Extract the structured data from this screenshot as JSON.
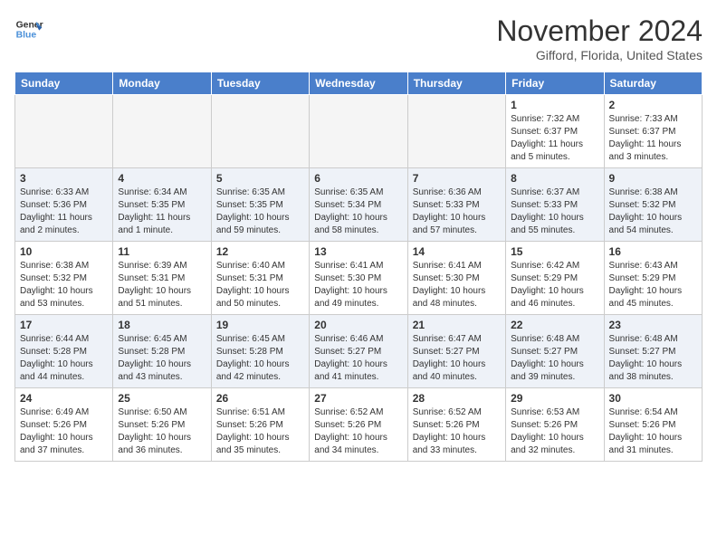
{
  "header": {
    "logo_line1": "General",
    "logo_line2": "Blue",
    "month": "November 2024",
    "location": "Gifford, Florida, United States"
  },
  "weekdays": [
    "Sunday",
    "Monday",
    "Tuesday",
    "Wednesday",
    "Thursday",
    "Friday",
    "Saturday"
  ],
  "weeks": [
    [
      {
        "day": "",
        "info": ""
      },
      {
        "day": "",
        "info": ""
      },
      {
        "day": "",
        "info": ""
      },
      {
        "day": "",
        "info": ""
      },
      {
        "day": "",
        "info": ""
      },
      {
        "day": "1",
        "info": "Sunrise: 7:32 AM\nSunset: 6:37 PM\nDaylight: 11 hours\nand 5 minutes."
      },
      {
        "day": "2",
        "info": "Sunrise: 7:33 AM\nSunset: 6:37 PM\nDaylight: 11 hours\nand 3 minutes."
      }
    ],
    [
      {
        "day": "3",
        "info": "Sunrise: 6:33 AM\nSunset: 5:36 PM\nDaylight: 11 hours\nand 2 minutes."
      },
      {
        "day": "4",
        "info": "Sunrise: 6:34 AM\nSunset: 5:35 PM\nDaylight: 11 hours\nand 1 minute."
      },
      {
        "day": "5",
        "info": "Sunrise: 6:35 AM\nSunset: 5:35 PM\nDaylight: 10 hours\nand 59 minutes."
      },
      {
        "day": "6",
        "info": "Sunrise: 6:35 AM\nSunset: 5:34 PM\nDaylight: 10 hours\nand 58 minutes."
      },
      {
        "day": "7",
        "info": "Sunrise: 6:36 AM\nSunset: 5:33 PM\nDaylight: 10 hours\nand 57 minutes."
      },
      {
        "day": "8",
        "info": "Sunrise: 6:37 AM\nSunset: 5:33 PM\nDaylight: 10 hours\nand 55 minutes."
      },
      {
        "day": "9",
        "info": "Sunrise: 6:38 AM\nSunset: 5:32 PM\nDaylight: 10 hours\nand 54 minutes."
      }
    ],
    [
      {
        "day": "10",
        "info": "Sunrise: 6:38 AM\nSunset: 5:32 PM\nDaylight: 10 hours\nand 53 minutes."
      },
      {
        "day": "11",
        "info": "Sunrise: 6:39 AM\nSunset: 5:31 PM\nDaylight: 10 hours\nand 51 minutes."
      },
      {
        "day": "12",
        "info": "Sunrise: 6:40 AM\nSunset: 5:31 PM\nDaylight: 10 hours\nand 50 minutes."
      },
      {
        "day": "13",
        "info": "Sunrise: 6:41 AM\nSunset: 5:30 PM\nDaylight: 10 hours\nand 49 minutes."
      },
      {
        "day": "14",
        "info": "Sunrise: 6:41 AM\nSunset: 5:30 PM\nDaylight: 10 hours\nand 48 minutes."
      },
      {
        "day": "15",
        "info": "Sunrise: 6:42 AM\nSunset: 5:29 PM\nDaylight: 10 hours\nand 46 minutes."
      },
      {
        "day": "16",
        "info": "Sunrise: 6:43 AM\nSunset: 5:29 PM\nDaylight: 10 hours\nand 45 minutes."
      }
    ],
    [
      {
        "day": "17",
        "info": "Sunrise: 6:44 AM\nSunset: 5:28 PM\nDaylight: 10 hours\nand 44 minutes."
      },
      {
        "day": "18",
        "info": "Sunrise: 6:45 AM\nSunset: 5:28 PM\nDaylight: 10 hours\nand 43 minutes."
      },
      {
        "day": "19",
        "info": "Sunrise: 6:45 AM\nSunset: 5:28 PM\nDaylight: 10 hours\nand 42 minutes."
      },
      {
        "day": "20",
        "info": "Sunrise: 6:46 AM\nSunset: 5:27 PM\nDaylight: 10 hours\nand 41 minutes."
      },
      {
        "day": "21",
        "info": "Sunrise: 6:47 AM\nSunset: 5:27 PM\nDaylight: 10 hours\nand 40 minutes."
      },
      {
        "day": "22",
        "info": "Sunrise: 6:48 AM\nSunset: 5:27 PM\nDaylight: 10 hours\nand 39 minutes."
      },
      {
        "day": "23",
        "info": "Sunrise: 6:48 AM\nSunset: 5:27 PM\nDaylight: 10 hours\nand 38 minutes."
      }
    ],
    [
      {
        "day": "24",
        "info": "Sunrise: 6:49 AM\nSunset: 5:26 PM\nDaylight: 10 hours\nand 37 minutes."
      },
      {
        "day": "25",
        "info": "Sunrise: 6:50 AM\nSunset: 5:26 PM\nDaylight: 10 hours\nand 36 minutes."
      },
      {
        "day": "26",
        "info": "Sunrise: 6:51 AM\nSunset: 5:26 PM\nDaylight: 10 hours\nand 35 minutes."
      },
      {
        "day": "27",
        "info": "Sunrise: 6:52 AM\nSunset: 5:26 PM\nDaylight: 10 hours\nand 34 minutes."
      },
      {
        "day": "28",
        "info": "Sunrise: 6:52 AM\nSunset: 5:26 PM\nDaylight: 10 hours\nand 33 minutes."
      },
      {
        "day": "29",
        "info": "Sunrise: 6:53 AM\nSunset: 5:26 PM\nDaylight: 10 hours\nand 32 minutes."
      },
      {
        "day": "30",
        "info": "Sunrise: 6:54 AM\nSunset: 5:26 PM\nDaylight: 10 hours\nand 31 minutes."
      }
    ]
  ]
}
